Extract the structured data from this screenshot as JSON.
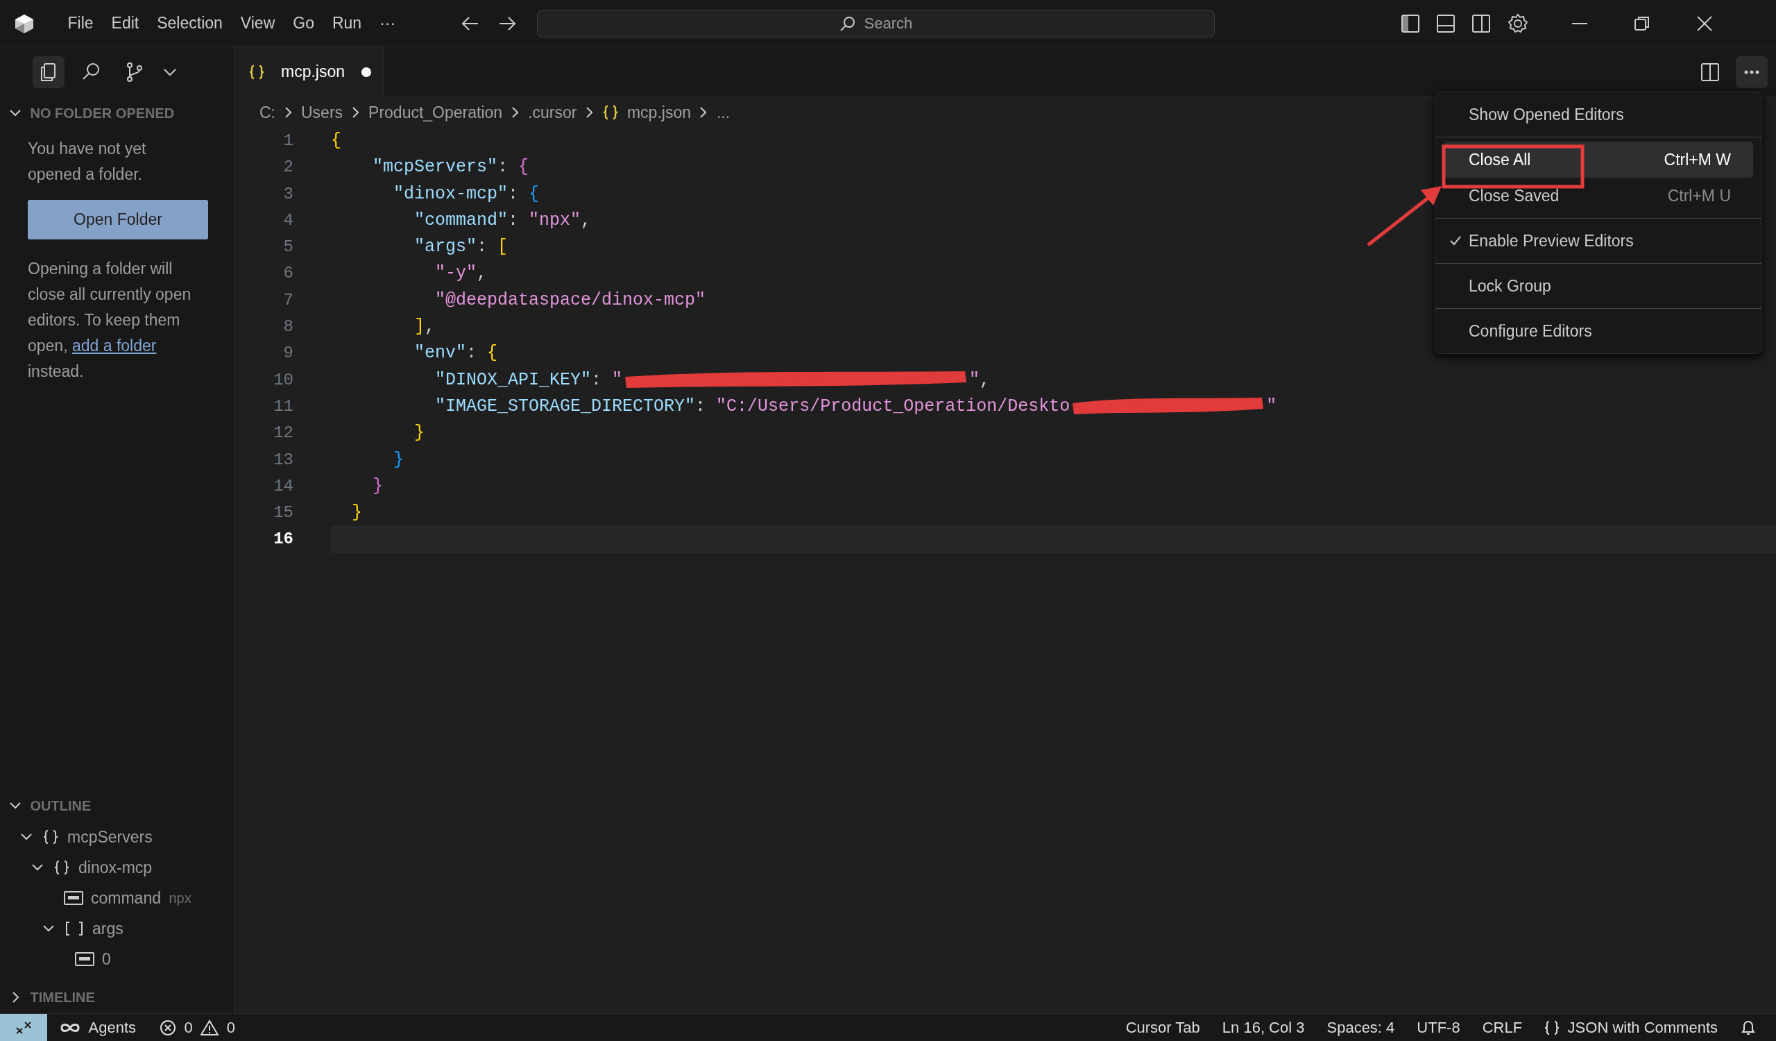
{
  "title_bar": {
    "menus": [
      "File",
      "Edit",
      "Selection",
      "View",
      "Go",
      "Run",
      "···"
    ],
    "search": {
      "placeholder": "Search"
    },
    "layout_toggles": [
      {
        "kind": "primary_sidebar",
        "on": true
      },
      {
        "kind": "panel",
        "on": false
      },
      {
        "kind": "secondary_sidebar",
        "on": false
      }
    ]
  },
  "activity_views": [
    {
      "kind": "explorer",
      "selected": true
    },
    {
      "kind": "search",
      "selected": false
    },
    {
      "kind": "source_control",
      "selected": false
    }
  ],
  "sidebar": {
    "header": "NO FOLDER OPENED",
    "message": "You have not yet opened a folder.",
    "button": "Open Folder",
    "note": {
      "before": "Opening a folder will close all currently open editors. To keep them open,",
      "link": "add a folder",
      "after": "instead."
    },
    "outline": {
      "header": "OUTLINE",
      "items": [
        {
          "kind": "object",
          "label": "mcpServers",
          "expanded": true,
          "children": [
            {
              "kind": "object",
              "label": "dinox-mcp",
              "expanded": true,
              "children": [
                {
                  "kind": "string",
                  "label": "command",
                  "detail": "npx"
                },
                {
                  "kind": "array",
                  "label": "args",
                  "expanded": true,
                  "children": [
                    {
                      "kind": "string",
                      "label": "0"
                    }
                  ]
                }
              ]
            }
          ]
        }
      ]
    },
    "timeline": {
      "header": "TIMELINE",
      "expanded": false
    }
  },
  "tabs": [
    {
      "label": "mcp.json",
      "selected": true,
      "dirty": true
    }
  ],
  "breadcrumb": [
    "C:",
    "Users",
    "Product_Operation",
    ".cursor",
    "mcp.json",
    "..."
  ],
  "code_lines": [
    {
      "number": "1",
      "active": false,
      "tokens": [
        {
          "kind": "bracket",
          "text": "{",
          "color": "#ffd700"
        }
      ]
    },
    {
      "number": "2",
      "active": false,
      "tokens": [
        {
          "kind": "key",
          "text": "    \"mcpServers\""
        },
        {
          "kind": "punct",
          "text": ": "
        },
        {
          "kind": "bracket",
          "text": "{",
          "color": "#da70d6"
        }
      ]
    },
    {
      "number": "3",
      "active": false,
      "tokens": [
        {
          "kind": "key",
          "text": "      \"dinox-mcp\""
        },
        {
          "kind": "punct",
          "text": ": "
        },
        {
          "kind": "bracket",
          "text": "{",
          "color": "#179fff"
        }
      ]
    },
    {
      "number": "4",
      "active": false,
      "tokens": [
        {
          "kind": "key",
          "text": "        \"command\""
        },
        {
          "kind": "punct",
          "text": ": "
        },
        {
          "kind": "string",
          "text": "\"npx\""
        },
        {
          "kind": "punct",
          "text": ","
        }
      ]
    },
    {
      "number": "5",
      "active": false,
      "tokens": [
        {
          "kind": "key",
          "text": "        \"args\""
        },
        {
          "kind": "punct",
          "text": ": "
        },
        {
          "kind": "bracket",
          "text": "[",
          "color": "#ffd700"
        }
      ]
    },
    {
      "number": "6",
      "active": false,
      "tokens": [
        {
          "kind": "string",
          "text": "          \"-y\""
        },
        {
          "kind": "punct",
          "text": ","
        }
      ]
    },
    {
      "number": "7",
      "active": false,
      "tokens": [
        {
          "kind": "string",
          "text": "          \"@deepdataspace/dinox-mcp\""
        }
      ]
    },
    {
      "number": "8",
      "active": false,
      "tokens": [
        {
          "kind": "bracket",
          "text": "        ]",
          "color": "#ffd700"
        },
        {
          "kind": "punct",
          "text": ","
        }
      ]
    },
    {
      "number": "9",
      "active": false,
      "tokens": [
        {
          "kind": "key",
          "text": "        \"env\""
        },
        {
          "kind": "punct",
          "text": ": "
        },
        {
          "kind": "bracket",
          "text": "{",
          "color": "#ffd700"
        }
      ]
    },
    {
      "number": "10",
      "active": false,
      "tokens": [
        {
          "kind": "key",
          "text": "          \"DINOX_API_KEY\""
        },
        {
          "kind": "punct",
          "text": ": "
        },
        {
          "kind": "string",
          "text": "\""
        },
        {
          "kind": "redacted"
        },
        {
          "kind": "string",
          "text": "\""
        },
        {
          "kind": "punct",
          "text": ","
        }
      ]
    },
    {
      "number": "11",
      "active": false,
      "tokens": [
        {
          "kind": "key",
          "text": "          \"IMAGE_STORAGE_DIRECTORY\""
        },
        {
          "kind": "punct",
          "text": ": "
        },
        {
          "kind": "string",
          "text": "\"C:/Users/Product_Operation/Deskto"
        },
        {
          "kind": "redacted"
        },
        {
          "kind": "string",
          "text": "\""
        }
      ]
    },
    {
      "number": "12",
      "active": false,
      "tokens": [
        {
          "kind": "bracket",
          "text": "        }",
          "color": "#ffd700"
        }
      ]
    },
    {
      "number": "13",
      "active": false,
      "tokens": [
        {
          "kind": "bracket",
          "text": "      }",
          "color": "#179fff"
        }
      ]
    },
    {
      "number": "14",
      "active": false,
      "tokens": [
        {
          "kind": "bracket",
          "text": "    }",
          "color": "#da70d6"
        }
      ]
    },
    {
      "number": "15",
      "active": false,
      "tokens": [
        {
          "kind": "bracket",
          "text": "  }",
          "color": "#ffd700"
        }
      ]
    },
    {
      "number": "16",
      "active": true
    }
  ],
  "context_menu": {
    "groups": [
      [
        {
          "label": "Show Opened Editors",
          "selected": false,
          "checked": false
        }
      ],
      [
        {
          "label": "Close All",
          "shortcut": "Ctrl+M W",
          "selected": true,
          "checked": false
        },
        {
          "label": "Close Saved",
          "shortcut": "Ctrl+M U",
          "selected": false,
          "checked": false
        }
      ],
      [
        {
          "label": "Enable Preview Editors",
          "selected": false,
          "checked": true
        }
      ],
      [
        {
          "label": "Lock Group",
          "selected": false,
          "checked": false
        }
      ],
      [
        {
          "label": "Configure Editors",
          "selected": false,
          "checked": false
        }
      ]
    ]
  },
  "status_bar": {
    "agents": "Agents",
    "errors": "0",
    "warnings": "0",
    "right": [
      {
        "kind": "text",
        "label": "Cursor Tab"
      },
      {
        "kind": "text",
        "label": "Ln 16, Col 3"
      },
      {
        "kind": "text",
        "label": "Spaces: 4"
      },
      {
        "kind": "text",
        "label": "UTF-8"
      },
      {
        "kind": "text",
        "label": "CRLF"
      },
      {
        "kind": "language",
        "label": "JSON with Comments"
      }
    ]
  }
}
